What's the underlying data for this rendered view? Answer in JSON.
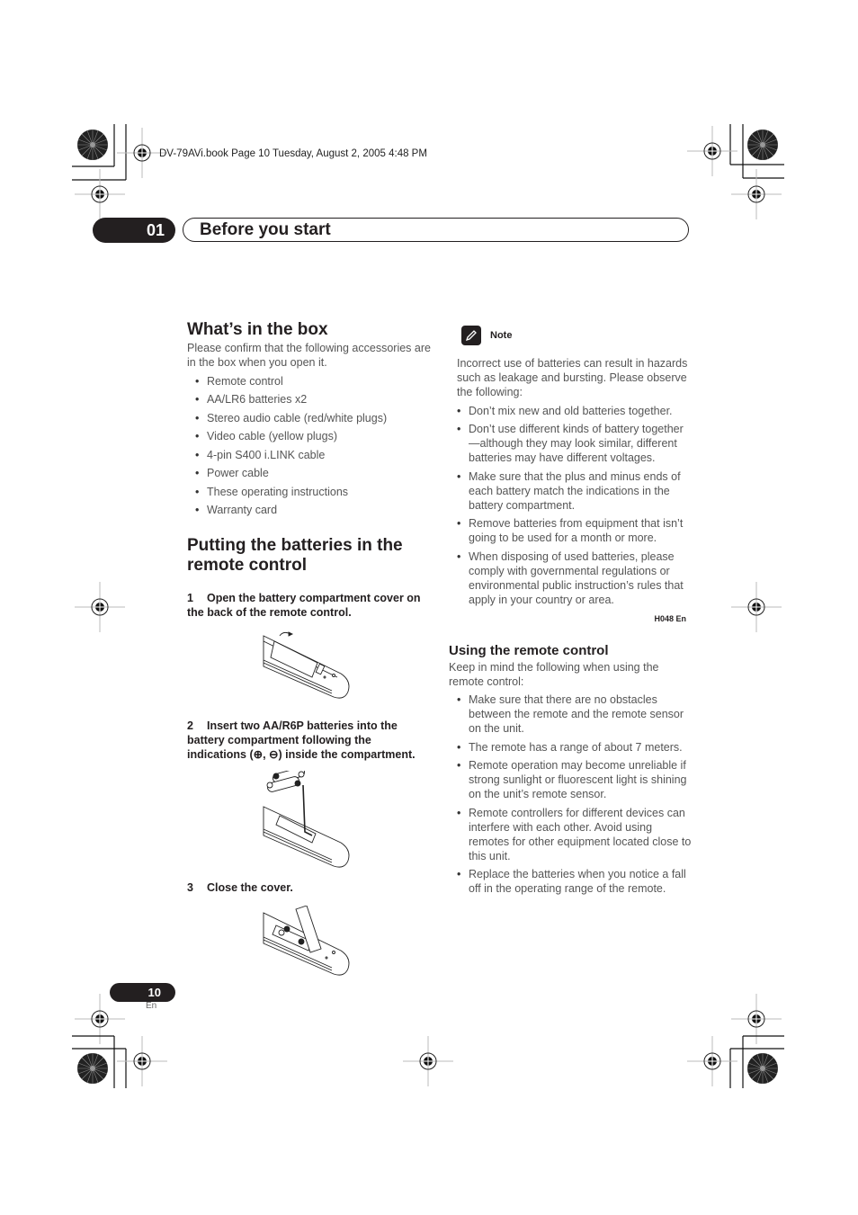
{
  "print_header": {
    "file_info": "DV-79AVi.book  Page 10  Tuesday, August 2, 2005  4:48 PM"
  },
  "chapter": {
    "number": "01",
    "title": "Before you start"
  },
  "whats_in_box": {
    "heading": "What’s in the box",
    "intro": "Please confirm that the following accessories are in the box when you open it.",
    "items": [
      "Remote control",
      "AA/LR6 batteries x2",
      "Stereo audio cable (red/white plugs)",
      "Video cable (yellow plugs)",
      "4-pin S400 i.LINK cable",
      "Power cable",
      "These operating instructions",
      "Warranty card"
    ]
  },
  "batteries": {
    "heading": "Putting the batteries in the remote control",
    "steps": [
      {
        "num": "1",
        "text": "Open the battery compartment cover on the back of the remote control.",
        "illustration": "remote-open-cover-illustration"
      },
      {
        "num": "2",
        "text": "Insert two AA/R6P batteries into the battery compartment following the indications (⊕, ⊖) inside the compartment.",
        "illustration": "remote-insert-batteries-illustration"
      },
      {
        "num": "3",
        "text": "Close the cover.",
        "illustration": "remote-close-cover-illustration"
      }
    ]
  },
  "note": {
    "icon": "pencil-icon",
    "label": "Note",
    "intro": "Incorrect use of batteries can result in hazards such as leakage and bursting. Please observe the following:",
    "items": [
      "Don’t mix new and old batteries together.",
      "Don’t use different kinds of battery together—although they may look similar, different batteries may have different voltages.",
      "Make sure that the plus and minus ends of each battery match the indications in the battery compartment.",
      "Remove batteries from equipment that isn’t going to be used for a month or more.",
      "When disposing of used batteries, please comply with governmental regulations or environmental public instruction’s rules that apply in your country or area."
    ],
    "code": "H048 En"
  },
  "using_remote": {
    "heading": "Using the remote control",
    "intro": "Keep in mind the following when using the remote control:",
    "items": [
      "Make sure that there are no obstacles between the remote and the remote sensor on the unit.",
      "The remote has a range of about 7 meters.",
      "Remote operation may become unreliable if strong sunlight or fluorescent light is shining on the unit’s remote sensor.",
      "Remote controllers for different devices can interfere with each other. Avoid using remotes for other equipment located close to this unit.",
      "Replace the batteries when you notice a fall off in the operating range of the remote."
    ]
  },
  "footer": {
    "page_number": "10",
    "language": "En"
  }
}
